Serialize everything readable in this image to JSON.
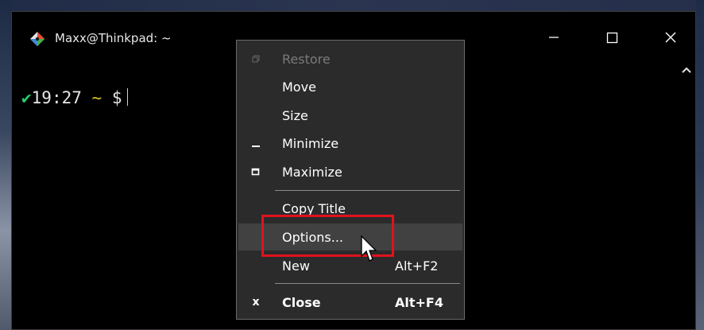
{
  "window": {
    "title": "Maxx@Thinkpad: ~",
    "app_icon": "git-bash-diamond-icon",
    "controls": [
      "minimize-icon",
      "maximize-icon",
      "close-icon"
    ]
  },
  "terminal": {
    "check": "✔",
    "time": "19:27",
    "cwd": "~",
    "prompt_symbol": "$"
  },
  "context_menu": {
    "items": [
      {
        "label": "Restore",
        "accel": "",
        "icon": "restore-icon",
        "disabled": true
      },
      {
        "label": "Move",
        "accel": "",
        "icon": ""
      },
      {
        "label": "Size",
        "accel": "",
        "icon": ""
      },
      {
        "label": "Minimize",
        "accel": "",
        "icon": "minimize-icon"
      },
      {
        "label": "Maximize",
        "accel": "",
        "icon": "maximize-icon"
      },
      {
        "label": "Copy Title",
        "accel": "",
        "icon": ""
      },
      {
        "label": "Options...",
        "accel": "",
        "icon": "",
        "hover": true
      },
      {
        "label": "New",
        "accel": "Alt+F2",
        "icon": ""
      },
      {
        "label": "Close",
        "accel": "Alt+F4",
        "icon": "close-x-icon",
        "bold": true
      }
    ],
    "close_glyph": "x"
  },
  "colors": {
    "highlight": "#e1121e",
    "check_green": "#23d16b",
    "tilde_yellow": "#d2c21d",
    "menu_bg": "#2b2b2b"
  }
}
